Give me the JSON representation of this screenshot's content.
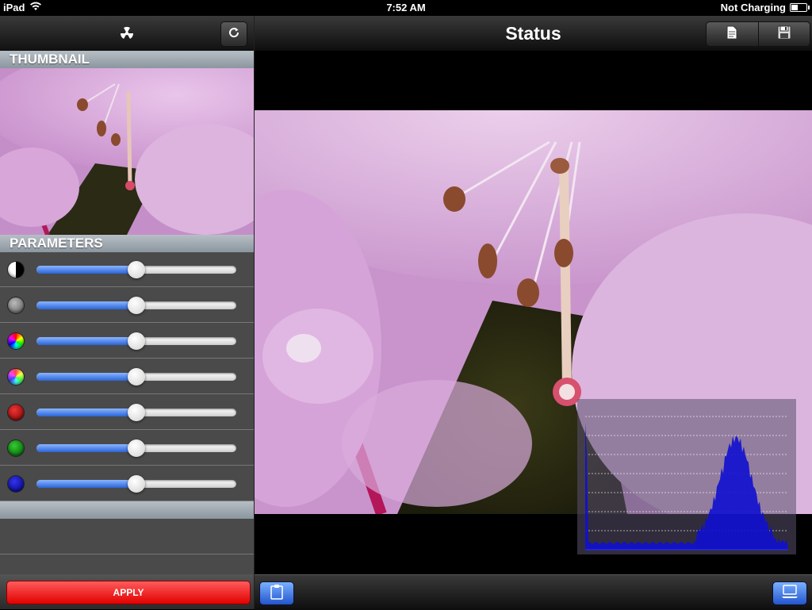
{
  "status_bar": {
    "device": "iPad",
    "time": "7:52 AM",
    "battery_status": "Not Charging",
    "battery_level": 0.45
  },
  "left_panel": {
    "thumbnail_header": "THUMBNAIL",
    "parameters_header": "PARAMETERS",
    "parameters": [
      {
        "icon": "contrast-icon",
        "value": 0.5
      },
      {
        "icon": "brightness-icon",
        "value": 0.5
      },
      {
        "icon": "hue-icon",
        "value": 0.5
      },
      {
        "icon": "saturation-icon",
        "value": 0.5
      },
      {
        "icon": "red-channel-icon",
        "value": 0.5
      },
      {
        "icon": "green-channel-icon",
        "value": 0.5
      },
      {
        "icon": "blue-channel-icon",
        "value": 0.5
      }
    ],
    "apply_label": "APPLY"
  },
  "right_panel": {
    "title": "Status"
  },
  "colors": {
    "apply": "#e10000",
    "slider_fill": "#2a64d8",
    "histogram": "#1010d0"
  }
}
